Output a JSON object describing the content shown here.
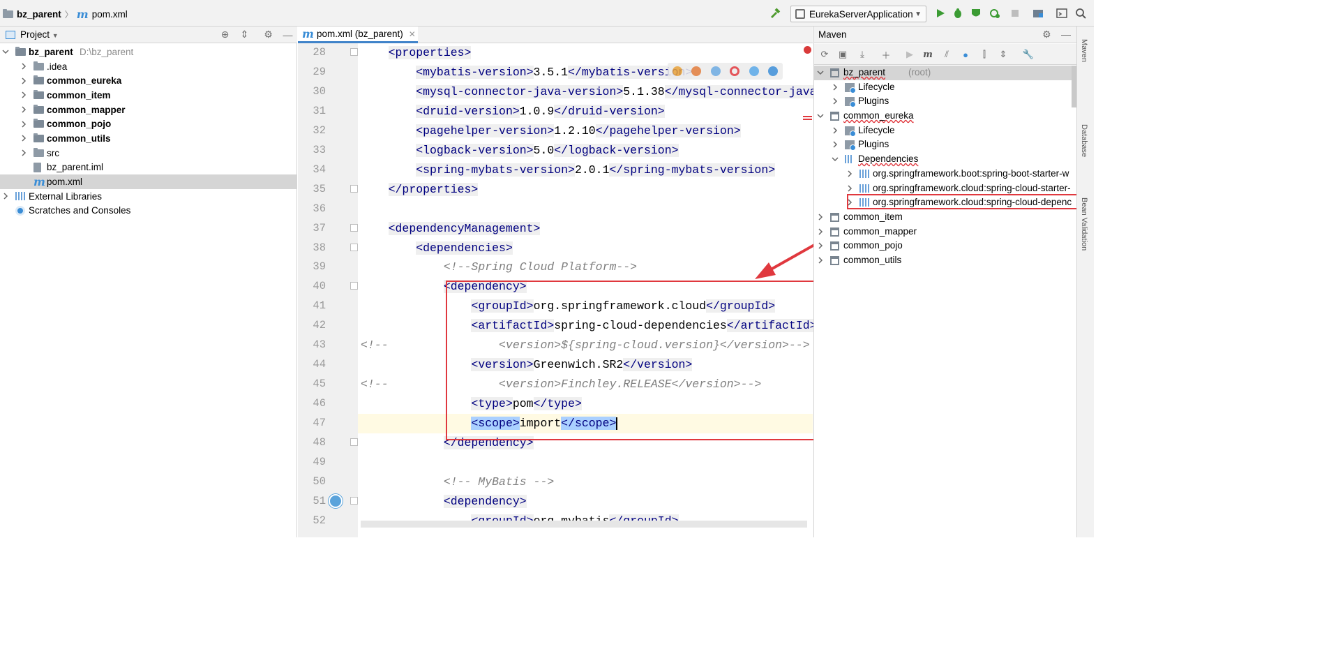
{
  "breadcrumb": {
    "project": "bz_parent",
    "file": "pom.xml"
  },
  "run_config": {
    "label": "EurekaServerApplication"
  },
  "colors": {
    "accent": "#4083c9",
    "highlight_box": "#e0383e",
    "tag": "#000080",
    "comment": "#808080"
  },
  "project_panel": {
    "title": "Project",
    "items": [
      {
        "label": "bz_parent",
        "extra": "D:\\bz_parent",
        "level": 0,
        "expanded": true,
        "bold": true,
        "icon": "module-folder-icon"
      },
      {
        "label": ".idea",
        "level": 1,
        "bold": false,
        "icon": "folder-icon"
      },
      {
        "label": "common_eureka",
        "level": 1,
        "bold": true,
        "icon": "module-folder-icon"
      },
      {
        "label": "common_item",
        "level": 1,
        "bold": true,
        "icon": "module-folder-icon"
      },
      {
        "label": "common_mapper",
        "level": 1,
        "bold": true,
        "icon": "module-folder-icon"
      },
      {
        "label": "common_pojo",
        "level": 1,
        "bold": true,
        "icon": "module-folder-icon"
      },
      {
        "label": "common_utils",
        "level": 1,
        "bold": true,
        "icon": "module-folder-icon"
      },
      {
        "label": "src",
        "level": 1,
        "bold": false,
        "icon": "folder-icon"
      },
      {
        "label": "bz_parent.iml",
        "level": 1,
        "bold": false,
        "icon": "iml-file-icon"
      },
      {
        "label": "pom.xml",
        "level": 1,
        "bold": false,
        "icon": "maven-file-icon",
        "selected": true
      },
      {
        "label": "External Libraries",
        "level": 0,
        "bold": false,
        "icon": "libraries-icon"
      },
      {
        "label": "Scratches and Consoles",
        "level": 0,
        "bold": false,
        "icon": "scratches-icon"
      }
    ]
  },
  "editor": {
    "tab_label": "pom.xml (bz_parent)",
    "current_line": 47,
    "lines": [
      {
        "n": "28",
        "indent": 4,
        "parts": [
          [
            "t",
            "<properties>"
          ]
        ]
      },
      {
        "n": "29",
        "indent": 8,
        "parts": [
          [
            "t",
            "<mybatis-version>"
          ],
          [
            "x",
            "3.5.1"
          ],
          [
            "t",
            "</mybatis-version>"
          ]
        ]
      },
      {
        "n": "30",
        "indent": 8,
        "parts": [
          [
            "t",
            "<mysql-connector-java-version>"
          ],
          [
            "x",
            "5.1.38"
          ],
          [
            "t",
            "</mysql-connector-java"
          ]
        ]
      },
      {
        "n": "31",
        "indent": 8,
        "parts": [
          [
            "t",
            "<druid-version>"
          ],
          [
            "x",
            "1.0.9"
          ],
          [
            "t",
            "</druid-version>"
          ]
        ]
      },
      {
        "n": "32",
        "indent": 8,
        "parts": [
          [
            "t",
            "<pagehelper-version>"
          ],
          [
            "x",
            "1.2.10"
          ],
          [
            "t",
            "</pagehelper-version>"
          ]
        ]
      },
      {
        "n": "33",
        "indent": 8,
        "parts": [
          [
            "t",
            "<logback-version>"
          ],
          [
            "x",
            "5.0"
          ],
          [
            "t",
            "</logback-version>"
          ]
        ]
      },
      {
        "n": "34",
        "indent": 8,
        "parts": [
          [
            "t",
            "<spring-mybats-version>"
          ],
          [
            "x",
            "2.0.1"
          ],
          [
            "t",
            "</spring-mybats-version>"
          ]
        ]
      },
      {
        "n": "35",
        "indent": 4,
        "parts": [
          [
            "t",
            "</properties>"
          ]
        ]
      },
      {
        "n": "36",
        "indent": 0,
        "parts": []
      },
      {
        "n": "37",
        "indent": 4,
        "parts": [
          [
            "t",
            "<dependencyManagement>"
          ]
        ]
      },
      {
        "n": "38",
        "indent": 8,
        "parts": [
          [
            "t",
            "<dependencies>"
          ]
        ]
      },
      {
        "n": "39",
        "indent": 12,
        "parts": [
          [
            "c",
            "<!--Spring Cloud Platform-->"
          ]
        ]
      },
      {
        "n": "40",
        "indent": 12,
        "parts": [
          [
            "t",
            "<dependency>"
          ]
        ]
      },
      {
        "n": "41",
        "indent": 16,
        "parts": [
          [
            "t",
            "<groupId>"
          ],
          [
            "x",
            "org.springframework.cloud"
          ],
          [
            "t",
            "</groupId>"
          ]
        ]
      },
      {
        "n": "42",
        "indent": 16,
        "parts": [
          [
            "t",
            "<artifactId>"
          ],
          [
            "x",
            "spring-cloud-dependencies"
          ],
          [
            "t",
            "</artifactId>"
          ]
        ]
      },
      {
        "n": "43",
        "indent": 0,
        "parts": [
          [
            "c",
            "<!--                <version>${spring-cloud.version}</version>-->"
          ]
        ]
      },
      {
        "n": "44",
        "indent": 16,
        "parts": [
          [
            "t",
            "<version>"
          ],
          [
            "x",
            "Greenwich.SR2"
          ],
          [
            "t",
            "</version>"
          ]
        ]
      },
      {
        "n": "45",
        "indent": 0,
        "parts": [
          [
            "c",
            "<!--                <version>Finchley.RELEASE</version>-->"
          ]
        ]
      },
      {
        "n": "46",
        "indent": 16,
        "parts": [
          [
            "t",
            "<type>"
          ],
          [
            "x",
            "pom"
          ],
          [
            "t",
            "</type>"
          ]
        ]
      },
      {
        "n": "47",
        "indent": 16,
        "parts": [
          [
            "h",
            "<scope>"
          ],
          [
            "x",
            "import"
          ],
          [
            "h",
            "</scope>"
          ]
        ]
      },
      {
        "n": "48",
        "indent": 12,
        "parts": [
          [
            "t",
            "</dependency>"
          ]
        ]
      },
      {
        "n": "49",
        "indent": 0,
        "parts": []
      },
      {
        "n": "50",
        "indent": 12,
        "parts": [
          [
            "c",
            "<!-- MyBatis -->"
          ]
        ]
      },
      {
        "n": "51",
        "indent": 12,
        "parts": [
          [
            "t",
            "<dependency>"
          ]
        ]
      },
      {
        "n": "52",
        "indent": 16,
        "parts": [
          [
            "t",
            "<groupId>"
          ],
          [
            "x",
            "org.mybatis"
          ],
          [
            "t",
            "</groupId>"
          ]
        ]
      }
    ]
  },
  "maven_panel": {
    "title": "Maven",
    "items": [
      {
        "label": "bz_parent",
        "extra": "(root)",
        "level": 0,
        "icon": "maven-module-icon",
        "selected": true,
        "squiggle": true
      },
      {
        "label": "Lifecycle",
        "level": 1,
        "icon": "lifecycle-icon"
      },
      {
        "label": "Plugins",
        "level": 1,
        "icon": "plugins-icon"
      },
      {
        "label": "common_eureka",
        "level": 0,
        "icon": "maven-module-icon",
        "squiggle": true
      },
      {
        "label": "Lifecycle",
        "level": 1,
        "icon": "lifecycle-icon"
      },
      {
        "label": "Plugins",
        "level": 1,
        "icon": "plugins-icon"
      },
      {
        "label": "Dependencies",
        "level": 1,
        "icon": "dependencies-icon",
        "squiggle": true
      },
      {
        "label": "org.springframework.boot:spring-boot-starter-w",
        "level": 2,
        "icon": "library-icon"
      },
      {
        "label": "org.springframework.cloud:spring-cloud-starter-",
        "level": 2,
        "icon": "library-icon"
      },
      {
        "label": "org.springframework.cloud:spring-cloud-depenc",
        "level": 2,
        "icon": "library-icon",
        "boxed": true
      },
      {
        "label": "common_item",
        "level": 0,
        "icon": "maven-module-icon"
      },
      {
        "label": "common_mapper",
        "level": 0,
        "icon": "maven-module-icon"
      },
      {
        "label": "common_pojo",
        "level": 0,
        "icon": "maven-module-icon"
      },
      {
        "label": "common_utils",
        "level": 0,
        "icon": "maven-module-icon"
      }
    ]
  },
  "side_strip": [
    "Maven",
    "Database",
    "Bean Validation"
  ]
}
